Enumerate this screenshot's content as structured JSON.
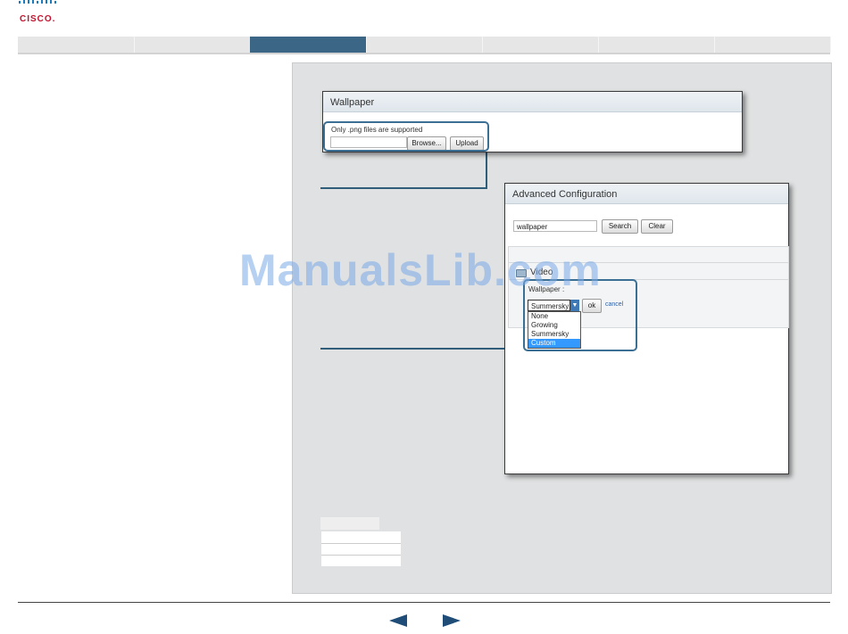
{
  "brand": {
    "name": "CISCO.",
    "color": "#c8102e",
    "bar_color": "#1b7bbd"
  },
  "nav": {
    "active_color": "#3b6686",
    "tab_count": 7,
    "active_index": 2
  },
  "wallpaper_dialog": {
    "title": "Wallpaper",
    "hint": "Only .png files are supported",
    "file_value": "",
    "browse_label": "Browse...",
    "upload_label": "Upload"
  },
  "advanced_dialog": {
    "title": "Advanced Configuration",
    "search_value": "wallpaper",
    "search_label": "Search",
    "clear_label": "Clear",
    "section": "Video",
    "field_label": "Wallpaper :",
    "selected_value": "Summersky",
    "ok_label": "ok",
    "cancel_label": "cancel",
    "options": [
      "None",
      "Growing",
      "Summersky",
      "Custom"
    ],
    "highlighted_option": "Custom"
  },
  "watermark": "ManualsLib.com",
  "navigation": {
    "prev_icon": "arrow-left-icon",
    "next_icon": "arrow-right-icon"
  }
}
